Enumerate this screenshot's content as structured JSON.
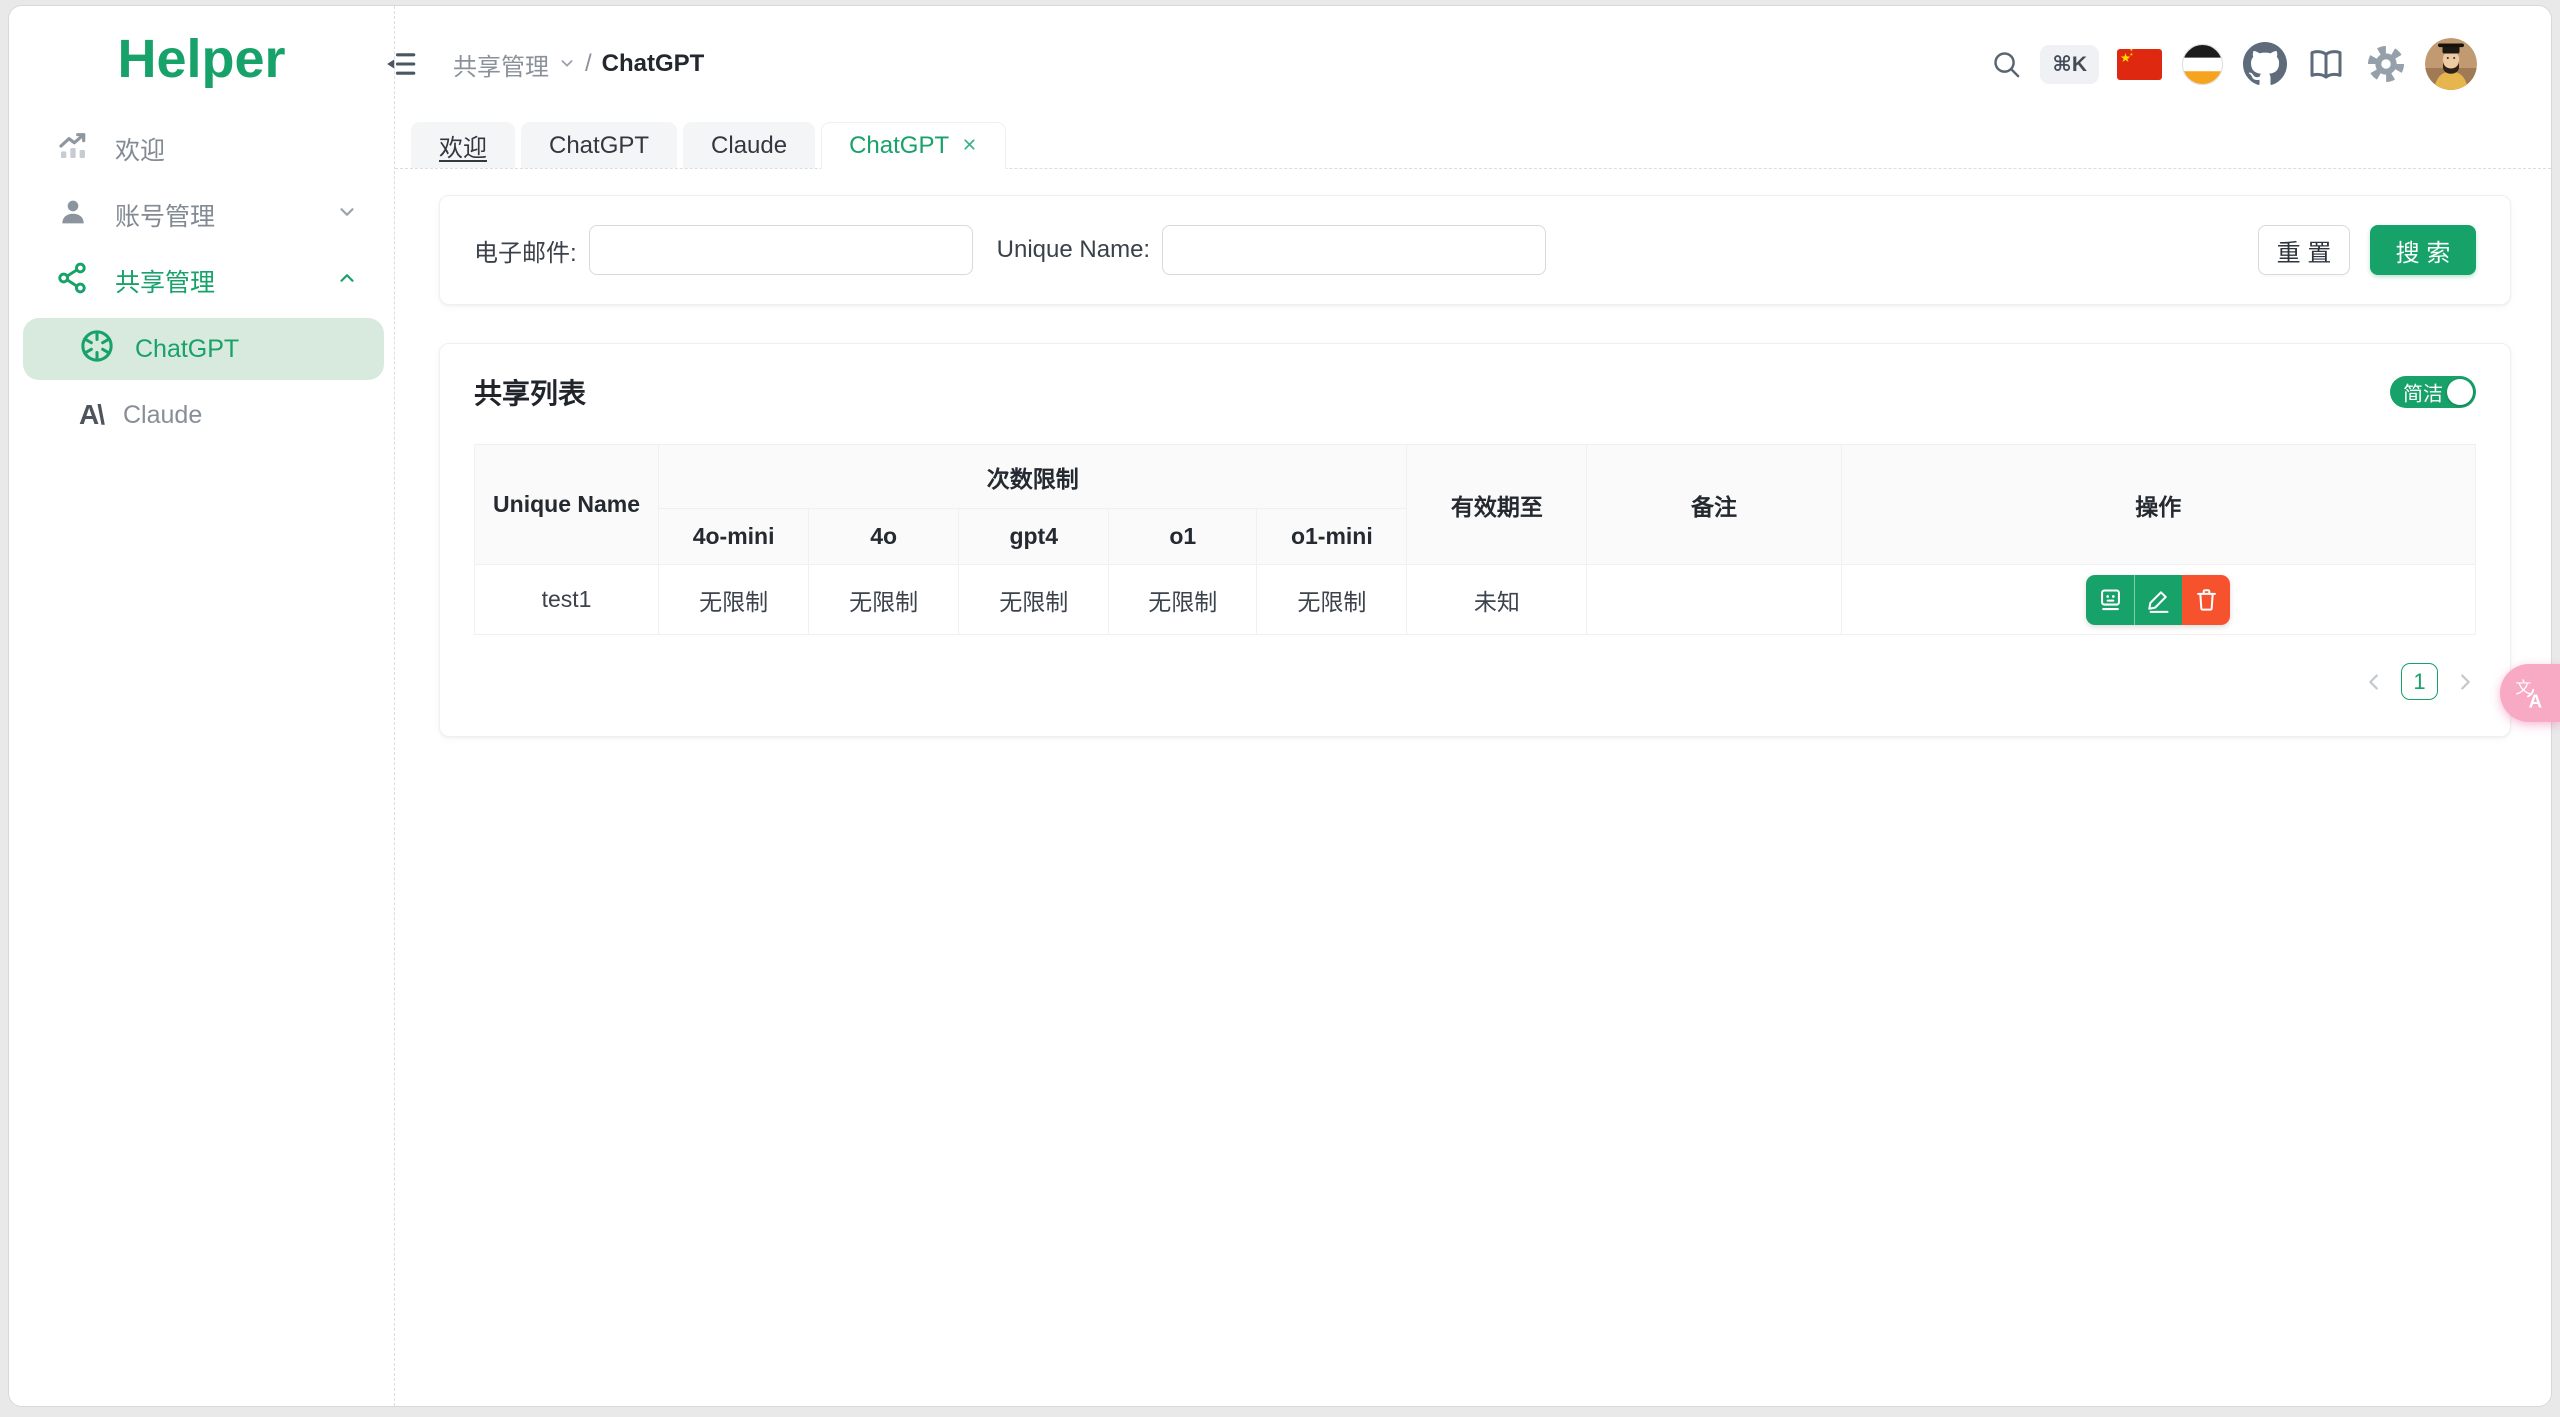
{
  "app": {
    "name": "Helper"
  },
  "colors": {
    "primary_green": "#17a26a",
    "active_pill_bg": "#d8e9dd",
    "danger_red": "#f5522d",
    "translate_pink": "#f8a9c3"
  },
  "sidebar": {
    "items": [
      {
        "label": "欢迎",
        "icon": "chart-trend-icon"
      },
      {
        "label": "账号管理",
        "icon": "user-icon",
        "chevron": "down"
      },
      {
        "label": "共享管理",
        "icon": "share-nodes-icon",
        "chevron": "up"
      }
    ],
    "submenu": [
      {
        "label": "ChatGPT",
        "icon": "openai-logo-icon",
        "active": true
      },
      {
        "label": "Claude",
        "icon": "claude-logo-icon",
        "glyph": "A\\"
      }
    ]
  },
  "header": {
    "breadcrumb": {
      "section": "共享管理",
      "separator": "/",
      "page": "ChatGPT"
    },
    "shortcut_badge": "⌘K",
    "icons": [
      "search-icon",
      "china-flag-icon",
      "theme-stripes-icon",
      "github-icon",
      "docs-book-icon",
      "settings-gear-icon",
      "avatar"
    ]
  },
  "tabs": [
    {
      "label": "欢迎"
    },
    {
      "label": "ChatGPT"
    },
    {
      "label": "Claude"
    },
    {
      "label": "ChatGPT",
      "active": true,
      "closable": true
    }
  ],
  "filter": {
    "email_label": "电子邮件:",
    "email_value": "",
    "unique_name_label": "Unique Name:",
    "unique_name_value": "",
    "reset_label": "重 置",
    "search_label": "搜 索"
  },
  "list": {
    "title": "共享列表",
    "toggle_label": "简洁",
    "toggle_state": "on",
    "table": {
      "headers": {
        "unique_name": "Unique Name",
        "limit_group": "次数限制",
        "models": [
          "4o-mini",
          "4o",
          "gpt4",
          "o1",
          "o1-mini"
        ],
        "valid_until": "有效期至",
        "remark": "备注",
        "actions": "操作"
      },
      "rows": [
        {
          "unique_name": "test1",
          "limits": [
            "无限制",
            "无限制",
            "无限制",
            "无限制",
            "无限制"
          ],
          "valid_until": "未知",
          "remark": ""
        }
      ]
    },
    "pagination": {
      "current_page": "1"
    }
  }
}
